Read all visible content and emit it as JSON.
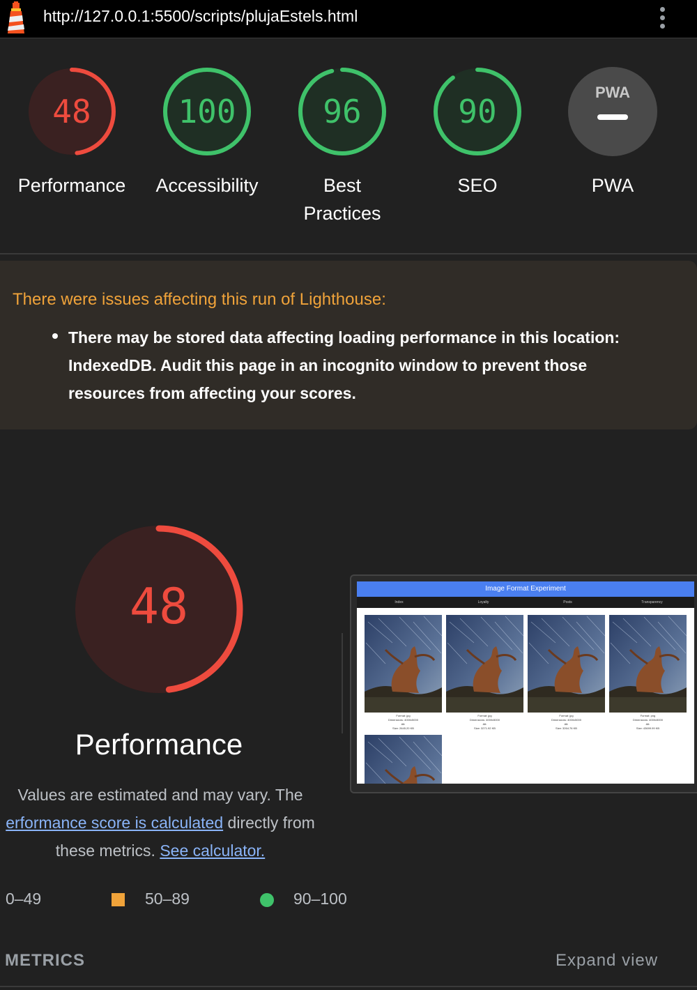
{
  "browser": {
    "url": "http://127.0.0.1:5500/scripts/plujaEstels.html"
  },
  "colors": {
    "fail": "#ee4b3e",
    "average": "#f0a33a",
    "pass": "#3fc26a",
    "link": "#8ab4f8"
  },
  "gauges": [
    {
      "score": "48",
      "label": "Performance",
      "value": 48,
      "rating": "fail"
    },
    {
      "score": "100",
      "label": "Accessibility",
      "value": 100,
      "rating": "pass"
    },
    {
      "score": "96",
      "label": "Best Practices",
      "value": 96,
      "rating": "pass"
    },
    {
      "score": "90",
      "label": "SEO",
      "value": 90,
      "rating": "pass"
    },
    {
      "score": "",
      "label": "PWA",
      "badge": "PWA",
      "rating": "na"
    }
  ],
  "warning": {
    "title": "There were issues affecting this run of Lighthouse:",
    "items": [
      "There may be stored data affecting loading performance in this location: IndexedDB. Audit this page in an incognito window to prevent those resources from affecting your scores."
    ]
  },
  "performance": {
    "score": "48",
    "value": 48,
    "title": "Performance",
    "desc_prefix": "Values are estimated and may vary. The",
    "desc_link1": "erformance score is calculated",
    "desc_middle": "directly from",
    "desc_suffix": "these metrics.",
    "desc_link2": "See calculator."
  },
  "legend": {
    "fail": "0–49",
    "average": "50–89",
    "pass": "90–100"
  },
  "screenshot": {
    "header": "Image Format Experiment",
    "nav": [
      "Index",
      "Loyalty",
      "Posts",
      "Transparency"
    ],
    "captions": [
      [
        "Format: jpg",
        "Dimensions: 4000x5000",
        "Alt:",
        "Size: 2645.20 KB"
      ],
      [
        "Format: jpg",
        "Dimensions: 4000x5000",
        "Alt:",
        "Size: 3271.92 KB"
      ],
      [
        "Format: jpg",
        "Dimensions: 4000x5000",
        "Alt:",
        "Size: 3264.76 KB"
      ],
      [
        "Format: png",
        "Dimensions: 4000x5000",
        "Alt:",
        "Size: 43699.99 KB"
      ]
    ]
  },
  "footer": {
    "metrics": "METRICS",
    "expand": "Expand view"
  }
}
